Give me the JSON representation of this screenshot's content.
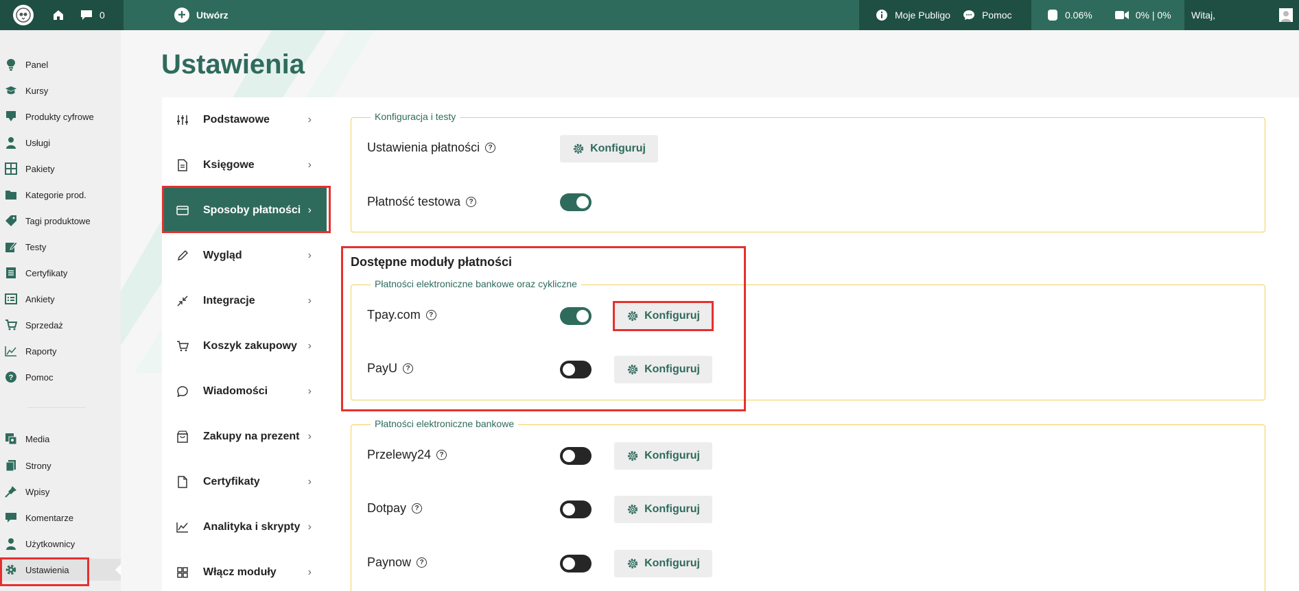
{
  "topbar": {
    "comments_count": "0",
    "create_label": "Utwórz",
    "my_publigo_label": "Moje Publigo",
    "help_label": "Pomoc",
    "storage_usage": "0.06%",
    "video_usage": "0% | 0%",
    "welcome_label": "Witaj,"
  },
  "sidebar": {
    "items": [
      {
        "label": "Panel",
        "icon": "lightbulb-icon"
      },
      {
        "label": "Kursy",
        "icon": "graduation-cap-icon"
      },
      {
        "label": "Produkty cyfrowe",
        "icon": "download-icon"
      },
      {
        "label": "Usługi",
        "icon": "person-icon"
      },
      {
        "label": "Pakiety",
        "icon": "grid-icon"
      },
      {
        "label": "Kategorie prod.",
        "icon": "folder-icon"
      },
      {
        "label": "Tagi produktowe",
        "icon": "tag-icon"
      },
      {
        "label": "Testy",
        "icon": "edit-icon"
      },
      {
        "label": "Certyfikaty",
        "icon": "document-icon"
      },
      {
        "label": "Ankiety",
        "icon": "list-icon"
      },
      {
        "label": "Sprzedaż",
        "icon": "cart-icon"
      },
      {
        "label": "Raporty",
        "icon": "chart-icon"
      },
      {
        "label": "Pomoc",
        "icon": "question-icon"
      }
    ],
    "items_bottom": [
      {
        "label": "Media",
        "icon": "media-icon"
      },
      {
        "label": "Strony",
        "icon": "pages-icon"
      },
      {
        "label": "Wpisy",
        "icon": "pin-icon"
      },
      {
        "label": "Komentarze",
        "icon": "comment-icon"
      },
      {
        "label": "Użytkownicy",
        "icon": "user-icon"
      },
      {
        "label": "Ustawienia",
        "icon": "gear-icon"
      }
    ]
  },
  "page": {
    "title": "Ustawienia"
  },
  "settings_nav": {
    "items": [
      {
        "label": "Podstawowe"
      },
      {
        "label": "Księgowe"
      },
      {
        "label": "Sposoby płatności"
      },
      {
        "label": "Wygląd"
      },
      {
        "label": "Integracje"
      },
      {
        "label": "Koszyk zakupowy"
      },
      {
        "label": "Wiadomości"
      },
      {
        "label": "Zakupy na prezent"
      },
      {
        "label": "Certyfikaty"
      },
      {
        "label": "Analityka i skrypty"
      },
      {
        "label": "Włącz moduły"
      }
    ]
  },
  "config_section": {
    "legend": "Konfiguracja i testy",
    "payment_settings_label": "Ustawienia płatności",
    "configure_label": "Konfiguruj",
    "test_payment_label": "Płatność testowa",
    "test_payment_on": true
  },
  "modules": {
    "title": "Dostępne moduły płatności",
    "group1": {
      "legend": "Płatności elektroniczne bankowe oraz cykliczne",
      "items": [
        {
          "label": "Tpay.com",
          "enabled": true,
          "button": "Konfiguruj"
        },
        {
          "label": "PayU",
          "enabled": false,
          "button": "Konfiguruj"
        }
      ]
    },
    "group2": {
      "legend": "Płatności elektroniczne bankowe",
      "items": [
        {
          "label": "Przelewy24",
          "enabled": false,
          "button": "Konfiguruj"
        },
        {
          "label": "Dotpay",
          "enabled": false,
          "button": "Konfiguruj"
        },
        {
          "label": "Paynow",
          "enabled": false,
          "button": "Konfiguruj"
        }
      ]
    }
  },
  "colors": {
    "brand": "#2f6b5c",
    "brand_dark": "#1f4f43",
    "fieldset_border": "#f2d15a",
    "highlight": "#e5302f"
  }
}
